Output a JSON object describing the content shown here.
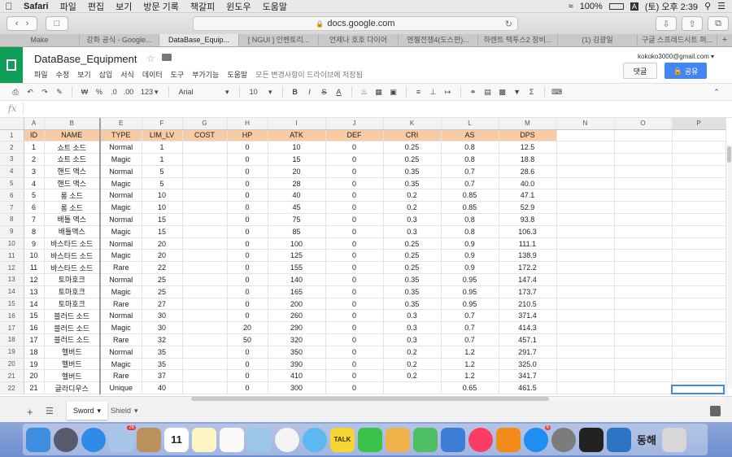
{
  "menubar": {
    "app": "Safari",
    "items": [
      "파일",
      "편집",
      "보기",
      "방문 기록",
      "책갈피",
      "윈도우",
      "도움말"
    ],
    "battery": "100%",
    "input_source": "A",
    "clock": "(토) 오후 2:39"
  },
  "safari": {
    "url": "docs.google.com",
    "tabs": [
      "Make",
      "강화 공식 - Google...",
      "DataBase_Equip...",
      "[ NGUI ] 인벤토리...",
      "언제나 호호 다이어",
      "엔젤전쟁4(도스판)...",
      "하렌트 택투스2 장비...",
      "(1) 김광일",
      "구글 스프레드시트 퍼..."
    ],
    "active_tab": 2
  },
  "sheet": {
    "title": "DataBase_Equipment",
    "menus": [
      "파일",
      "수정",
      "보기",
      "삽입",
      "서식",
      "데이터",
      "도구",
      "부가기능",
      "도움말"
    ],
    "saved_message": "모든 변경사항이 드라이브에 저장됨",
    "account": "kokoko3000@gmail.com",
    "comment_label": "댓글",
    "share_label": "공유"
  },
  "format_toolbar": {
    "currency": "₩",
    "percent": "%",
    "dec_decrease": ".0",
    "dec_increase": ".00",
    "more_formats": "123",
    "font": "Arial",
    "font_size": "10",
    "bold": "B",
    "italic": "I",
    "strike": "S",
    "text_color": "A"
  },
  "formula_bar": {
    "fx": "fx"
  },
  "columns": [
    "A",
    "B",
    "E",
    "F",
    "G",
    "H",
    "I",
    "J",
    "K",
    "L",
    "M",
    "N",
    "O",
    "P"
  ],
  "header_row": [
    "ID",
    "NAME",
    "TYPE",
    "LIM_LV",
    "COST",
    "HP",
    "ATK",
    "DEF",
    "CRI",
    "AS",
    "DPS"
  ],
  "rows": [
    [
      "1",
      "쇼트 소드",
      "Normal",
      "1",
      "",
      "0",
      "10",
      "0",
      "0.25",
      "0.8",
      "12.5"
    ],
    [
      "2",
      "쇼트 소드",
      "Magic",
      "1",
      "",
      "0",
      "15",
      "0",
      "0.25",
      "0.8",
      "18.8"
    ],
    [
      "3",
      "핸드 액스",
      "Normal",
      "5",
      "",
      "0",
      "20",
      "0",
      "0.35",
      "0.7",
      "28.6"
    ],
    [
      "4",
      "핸드 액스",
      "Magic",
      "5",
      "",
      "0",
      "28",
      "0",
      "0.35",
      "0.7",
      "40.0"
    ],
    [
      "5",
      "롱 소드",
      "Normal",
      "10",
      "",
      "0",
      "40",
      "0",
      "0.2",
      "0.85",
      "47.1"
    ],
    [
      "6",
      "롱 소드",
      "Magic",
      "10",
      "",
      "0",
      "45",
      "0",
      "0.2",
      "0.85",
      "52.9"
    ],
    [
      "7",
      "배틀 액스",
      "Normal",
      "15",
      "",
      "0",
      "75",
      "0",
      "0.3",
      "0.8",
      "93.8"
    ],
    [
      "8",
      "배틀액스",
      "Magic",
      "15",
      "",
      "0",
      "85",
      "0",
      "0.3",
      "0.8",
      "106.3"
    ],
    [
      "9",
      "바스타드 소드",
      "Normal",
      "20",
      "",
      "0",
      "100",
      "0",
      "0.25",
      "0.9",
      "111.1"
    ],
    [
      "10",
      "바스타드 소드",
      "Magic",
      "20",
      "",
      "0",
      "125",
      "0",
      "0.25",
      "0.9",
      "138.9"
    ],
    [
      "11",
      "바스타드 소드",
      "Rare",
      "22",
      "",
      "0",
      "155",
      "0",
      "0.25",
      "0.9",
      "172.2"
    ],
    [
      "12",
      "토마호크",
      "Normal",
      "25",
      "",
      "0",
      "140",
      "0",
      "0.35",
      "0.95",
      "147.4"
    ],
    [
      "13",
      "토마호크",
      "Magic",
      "25",
      "",
      "0",
      "165",
      "0",
      "0.35",
      "0.95",
      "173.7"
    ],
    [
      "14",
      "토마호크",
      "Rare",
      "27",
      "",
      "0",
      "200",
      "0",
      "0.35",
      "0.95",
      "210.5"
    ],
    [
      "15",
      "블러드 소드",
      "Normal",
      "30",
      "",
      "0",
      "260",
      "0",
      "0.3",
      "0.7",
      "371.4"
    ],
    [
      "16",
      "블러드 소드",
      "Magic",
      "30",
      "",
      "20",
      "290",
      "0",
      "0.3",
      "0.7",
      "414.3"
    ],
    [
      "17",
      "블러드 소드",
      "Rare",
      "32",
      "",
      "50",
      "320",
      "0",
      "0.3",
      "0.7",
      "457.1"
    ],
    [
      "18",
      "헬버드",
      "Normal",
      "35",
      "",
      "0",
      "350",
      "0",
      "0.2",
      "1.2",
      "291.7"
    ],
    [
      "19",
      "헬버드",
      "Magic",
      "35",
      "",
      "0",
      "390",
      "0",
      "0.2",
      "1.2",
      "325.0"
    ],
    [
      "20",
      "헬버드",
      "Rare",
      "37",
      "",
      "0",
      "410",
      "0",
      "0.2",
      "1.2",
      "341.7"
    ],
    [
      "21",
      "글라디우스",
      "Unique",
      "40",
      "",
      "0",
      "300",
      "0",
      "",
      "0.65",
      "461.5"
    ]
  ],
  "sheet_tabs": [
    "Sword",
    "Shield"
  ],
  "active_sheet": 0,
  "dock": {
    "calendar_day": "11",
    "photos_badge": "26",
    "appstore_badge": "6",
    "talk_label": "TALK",
    "last_label": "동해"
  },
  "colors": {
    "header_fill": "#f8cba4",
    "sheets_green": "#0f9d58",
    "share_blue": "#4285f4"
  }
}
